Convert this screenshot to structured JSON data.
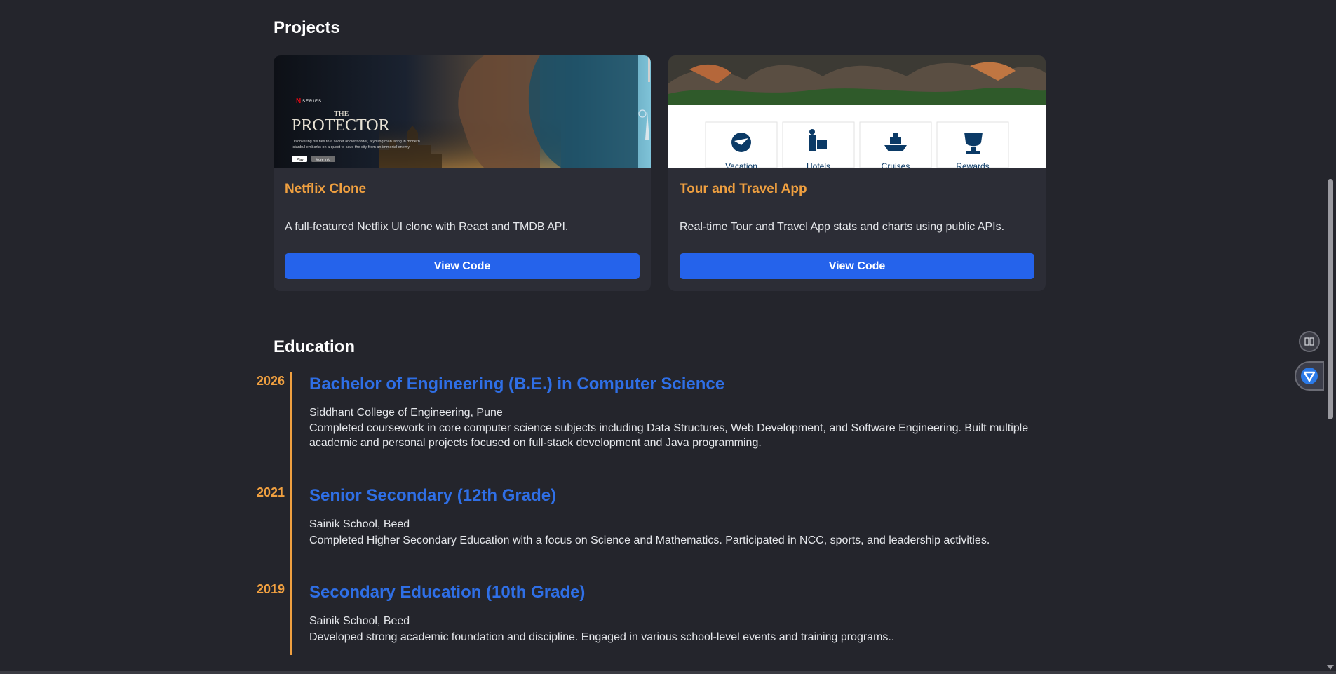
{
  "projects": {
    "heading": "Projects",
    "items": [
      {
        "title": "Netflix Clone",
        "description": "A full-featured Netflix UI clone with React and TMDB API.",
        "button": "View Code",
        "thumb": {
          "series_label": "SERIES",
          "brand_letter": "N",
          "title_small": "THE",
          "title_large": "PROTECTOR",
          "blurb": "Discovering his ties to a secret ancient order, a young man living in modern Istanbul embarks on a quest to save the city from an immortal enemy.",
          "play_label": "Play",
          "more_label": "More Info"
        }
      },
      {
        "title": "Tour and Travel App",
        "description": "Real-time Tour and Travel App stats and charts using public APIs.",
        "button": "View Code",
        "thumb": {
          "tiles": [
            "Vacation",
            "Hotels",
            "Cruises",
            "Rewards"
          ]
        }
      }
    ]
  },
  "education": {
    "heading": "Education",
    "items": [
      {
        "year": "2026",
        "degree": "Bachelor of Engineering (B.E.) in Computer Science",
        "school": "Siddhant College of Engineering, Pune",
        "description": "Completed coursework in core computer science subjects including Data Structures, Web Development, and Software Engineering. Built multiple academic and personal projects focused on full-stack development and Java programming."
      },
      {
        "year": "2021",
        "degree": "Senior Secondary (12th Grade)",
        "school": "Sainik School, Beed",
        "description": "Completed Higher Secondary Education with a focus on Science and Mathematics. Participated in NCC, sports, and leadership activities."
      },
      {
        "year": "2019",
        "degree": "Secondary Education (10th Grade)",
        "school": "Sainik School, Beed",
        "description": "Developed strong academic foundation and discipline. Engaged in various school-level events and training programs.."
      }
    ]
  },
  "colors": {
    "background": "#24252c",
    "card": "#2c2d36",
    "accent_orange": "#f0a040",
    "accent_blue": "#2563eb",
    "degree_blue": "#2f6fe6"
  },
  "side_widgets": [
    "reader-icon",
    "extension-icon"
  ],
  "scroll_position": 0.28
}
